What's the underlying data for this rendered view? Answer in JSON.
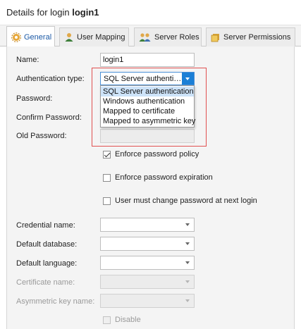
{
  "title": {
    "prefix": "Details for login",
    "name": "login1"
  },
  "tabs": [
    {
      "label": "General",
      "icon": "gear-icon",
      "active": true
    },
    {
      "label": "User Mapping",
      "icon": "user-icon",
      "active": false
    },
    {
      "label": "Server Roles",
      "icon": "users-icon",
      "active": false
    },
    {
      "label": "Server Permissions",
      "icon": "key-icon",
      "active": false
    }
  ],
  "form": {
    "name_label": "Name:",
    "name_value": "login1",
    "auth_label": "Authentication type:",
    "auth_value": "SQL Server authenti…",
    "auth_options": [
      "SQL Server authentication",
      "Windows authentication",
      "Mapped to certificate",
      "Mapped to asymmetric key"
    ],
    "password_label": "Password:",
    "confirm_label": "Confirm Password:",
    "old_password_label": "Old Password:",
    "enforce_policy_label": "Enforce password policy",
    "enforce_policy_checked": true,
    "enforce_expiration_label": "Enforce password expiration",
    "enforce_expiration_checked": false,
    "must_change_label": "User must change password at next login",
    "must_change_checked": false,
    "credential_label": "Credential name:",
    "default_db_label": "Default database:",
    "default_lang_label": "Default language:",
    "certificate_label": "Certificate name:",
    "asym_key_label": "Asymmetric key name:",
    "disable_label": "Disable"
  },
  "colors": {
    "accent": "#1b7fd6",
    "highlight": "#e05050",
    "selected_option": "#cde3f9"
  }
}
